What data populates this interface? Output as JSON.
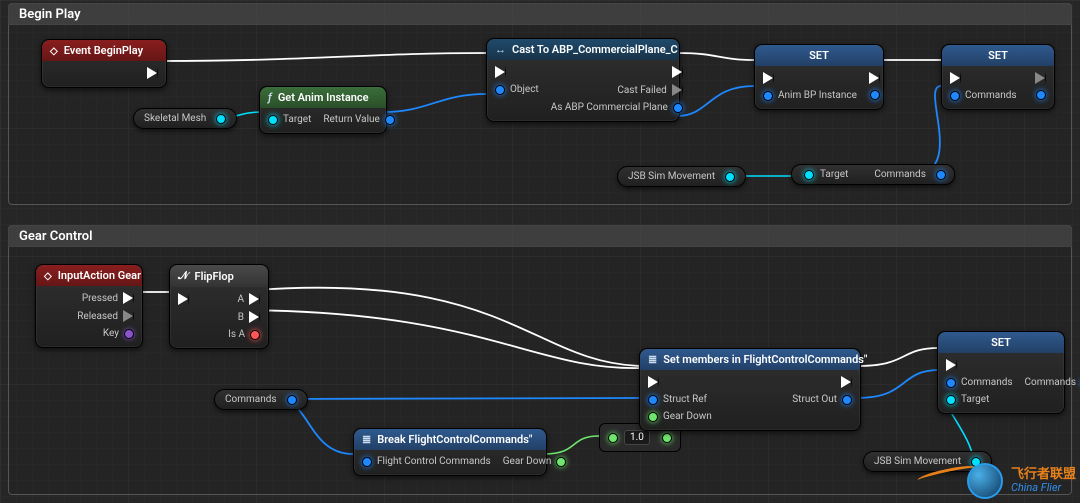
{
  "sections": {
    "begin_play": {
      "title": "Begin Play"
    },
    "gear_control": {
      "title": "Gear Control"
    }
  },
  "nodes": {
    "event_begin_play": {
      "title": "Event BeginPlay"
    },
    "skeletal_mesh": {
      "label": "Skeletal Mesh"
    },
    "get_anim_instance": {
      "title": "Get Anim Instance",
      "pins": {
        "target": "Target",
        "return": "Return Value"
      }
    },
    "cast_abp": {
      "title": "Cast To ABP_CommercialPlane_C",
      "pins": {
        "object": "Object",
        "cast_failed": "Cast Failed",
        "as": "As ABP Commercial Plane"
      }
    },
    "set1": {
      "title": "SET",
      "pins": {
        "var": "Anim BP Instance"
      }
    },
    "set2": {
      "title": "SET",
      "pins": {
        "var": "Commands"
      }
    },
    "jsb_sim_movement1": {
      "label": "JSB Sim Movement"
    },
    "jsb_get_commands": {
      "pins": {
        "target": "Target",
        "commands": "Commands"
      }
    },
    "input_action_gear": {
      "title": "InputAction Gear",
      "pins": {
        "pressed": "Pressed",
        "released": "Released",
        "key": "Key"
      }
    },
    "flipflop": {
      "title": "FlipFlop",
      "pins": {
        "a": "A",
        "b": "B",
        "is_a": "Is A"
      }
    },
    "commands_var": {
      "label": "Commands"
    },
    "break_fcc": {
      "title": "Break FlightControlCommands\"",
      "pins": {
        "in": "Flight Control Commands",
        "gear_down": "Gear Down"
      }
    },
    "numbox": {
      "value": "1.0"
    },
    "set_members": {
      "title": "Set members in FlightControlCommands\"",
      "pins": {
        "struct_ref": "Struct Ref",
        "gear_down": "Gear Down",
        "struct_out": "Struct Out"
      }
    },
    "set3": {
      "title": "SET",
      "pins_left": {
        "commands": "Commands",
        "target": "Target"
      },
      "pins_right": {
        "commands": "Commands"
      }
    },
    "jsb_sim_movement2": {
      "label": "JSB Sim Movement"
    }
  },
  "watermark": {
    "cn": "飞行者联盟",
    "en": "China Flier"
  }
}
